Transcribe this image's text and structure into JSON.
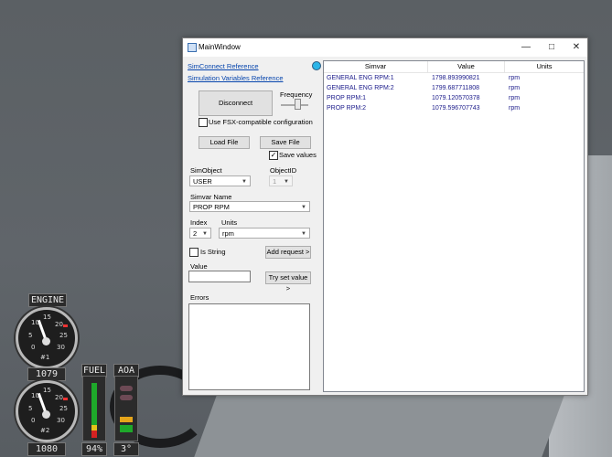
{
  "window": {
    "title": "MainWindow",
    "controls": {
      "minimize": "—",
      "maximize": "□",
      "close": "✕"
    }
  },
  "links": {
    "simconnect_reference": "SimConnect Reference",
    "simulation_variables_reference": "Simulation Variables Reference"
  },
  "connection": {
    "disconnect_label": "Disconnect",
    "status_color": "#2bb5e8"
  },
  "frequency": {
    "label": "Frequency"
  },
  "options": {
    "fsx_compatible_label": "Use FSX-compatible configuration",
    "fsx_compatible_checked": false,
    "save_values_label": "Save values",
    "save_values_checked": true,
    "check_mark": "✓"
  },
  "file": {
    "load_label": "Load File",
    "save_label": "Save File"
  },
  "simobject": {
    "label": "SimObject",
    "value": "USER"
  },
  "objectid": {
    "label": "ObjectID",
    "value": "1"
  },
  "simvar_name": {
    "label": "Simvar Name",
    "value": "PROP RPM"
  },
  "index": {
    "label": "Index",
    "value": "2"
  },
  "units": {
    "label": "Units",
    "value": "rpm"
  },
  "is_string": {
    "label": "Is String",
    "checked": false
  },
  "add_request": {
    "label": "Add request >"
  },
  "value": {
    "label": "Value",
    "current": ""
  },
  "try_set_value": {
    "label": "Try set value >"
  },
  "errors": {
    "label": "Errors"
  },
  "grid": {
    "headers": [
      "Simvar",
      "Value",
      "Units"
    ],
    "rows": [
      {
        "simvar": "GENERAL ENG RPM:1",
        "value": "1798.893990821",
        "units": "rpm"
      },
      {
        "simvar": "GENERAL ENG RPM:2",
        "value": "1799.687711808",
        "units": "rpm"
      },
      {
        "simvar": "PROP RPM:1",
        "value": "1079.120570378",
        "units": "rpm"
      },
      {
        "simvar": "PROP RPM:2",
        "value": "1079.596707743",
        "units": "rpm"
      }
    ]
  },
  "cockpit": {
    "engine_label": "ENGINE",
    "gauge1": {
      "ticks": [
        "10",
        "15",
        "20",
        "25",
        "30",
        "5",
        "0"
      ],
      "id": "#1",
      "readout": "1079"
    },
    "gauge2": {
      "ticks": [
        "10",
        "15",
        "20",
        "25",
        "30",
        "5",
        "0"
      ],
      "id": "#2",
      "readout": "1080"
    },
    "fuel": {
      "label": "FUEL",
      "readout": "94%",
      "level_fraction": 0.94
    },
    "aoa": {
      "label": "AOA",
      "readout": "3°"
    }
  }
}
